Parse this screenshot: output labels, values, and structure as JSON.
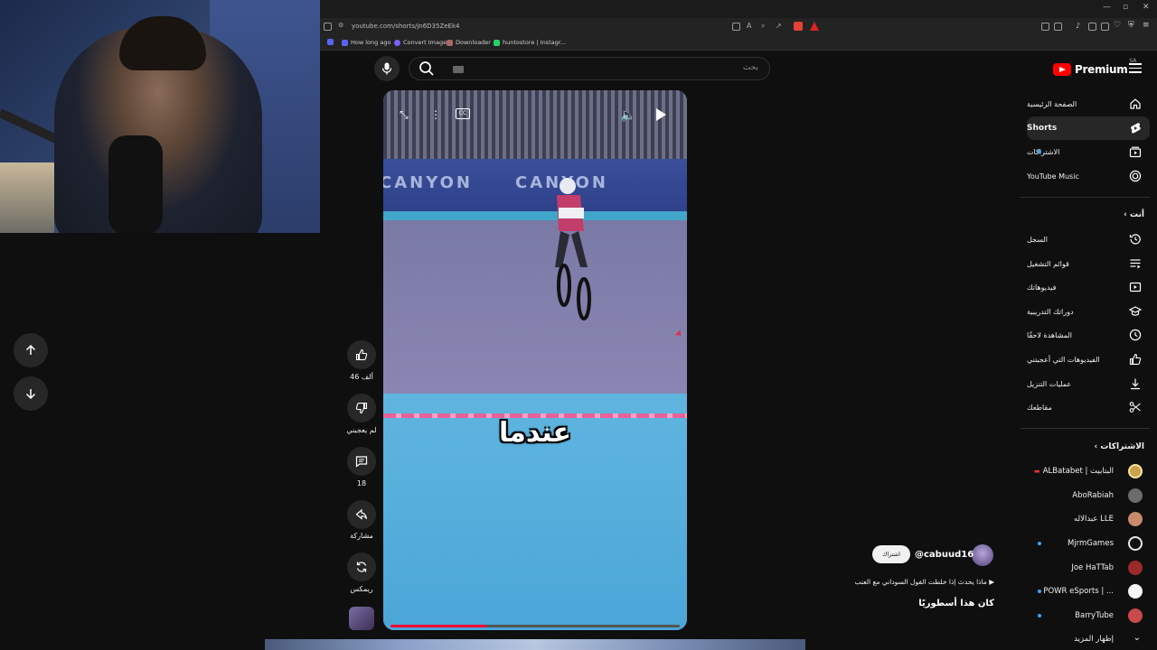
{
  "browser": {
    "url": "youtube.com/shorts/jn6D35ZeEk4",
    "bookmarks": [
      {
        "label": "How long ago",
        "color": "#5865f2"
      },
      {
        "label": "Convert Image",
        "color": "#7b61ff"
      },
      {
        "label": "Downloader",
        "color": "#a66"
      },
      {
        "label": "huntostore | Instagr...",
        "color": "#25d366"
      }
    ]
  },
  "search": {
    "placeholder": "بحث"
  },
  "logo": {
    "text": "Premium",
    "region": "SA"
  },
  "sidebar": {
    "main": [
      {
        "label": "الصفحة الرئيسية",
        "icon": "home-icon"
      },
      {
        "label": "Shorts",
        "icon": "shorts-icon",
        "active": true
      },
      {
        "label": "الاشتراكات",
        "icon": "subscriptions-icon",
        "dot": true
      },
      {
        "label": "YouTube Music",
        "icon": "music-icon"
      }
    ],
    "you_header": "أنت",
    "you": [
      {
        "label": "السجل",
        "icon": "history-icon"
      },
      {
        "label": "قوائم التشغيل",
        "icon": "playlists-icon"
      },
      {
        "label": "فيديوهاتك",
        "icon": "your-videos-icon"
      },
      {
        "label": "دوراتك التدريبية",
        "icon": "courses-icon"
      },
      {
        "label": "المشاهدة لاحقًا",
        "icon": "watch-later-icon"
      },
      {
        "label": "الفيديوهات التي أعجبتني",
        "icon": "liked-icon"
      },
      {
        "label": "عمليات التنزيل",
        "icon": "download-icon"
      },
      {
        "label": "مقاطعك",
        "icon": "clips-icon"
      }
    ],
    "subs_header": "الاشتراكات",
    "subscriptions": [
      {
        "label": "ALBatabet | البتابيت",
        "color": "#c9a24a",
        "dot": false,
        "live": true
      },
      {
        "label": "AboRabiah",
        "color": "#6b6b6b",
        "dot": false
      },
      {
        "label": "عبدالاله LLE",
        "color": "#c88a6a",
        "dot": false
      },
      {
        "label": "MjrmGames",
        "color": "#e6e6e6",
        "dot": true
      },
      {
        "label": "Joe HaTTab",
        "color": "#9b2b2b",
        "dot": false
      },
      {
        "label": "POWR eSports | ...",
        "color": "#f5f5f5",
        "dot": true
      },
      {
        "label": "BarryTube",
        "color": "#c84a4a",
        "dot": true
      }
    ],
    "show_more": "إظهار المزيد"
  },
  "video": {
    "caption": "عندما",
    "banner_text": "CANYON",
    "progress": 0.33
  },
  "actions": {
    "likes": "46 ألف",
    "dislike": "لم يعجبني",
    "comments": "18",
    "share": "مشاركة",
    "remix": "ريمكس"
  },
  "channel": {
    "handle": "@cabuud16",
    "subscribe": "اشتراك",
    "sound": "ماذا يحدث إذا خلطت الفول السوداني مع العنب",
    "description": "كان هذا أسطوريًا"
  }
}
